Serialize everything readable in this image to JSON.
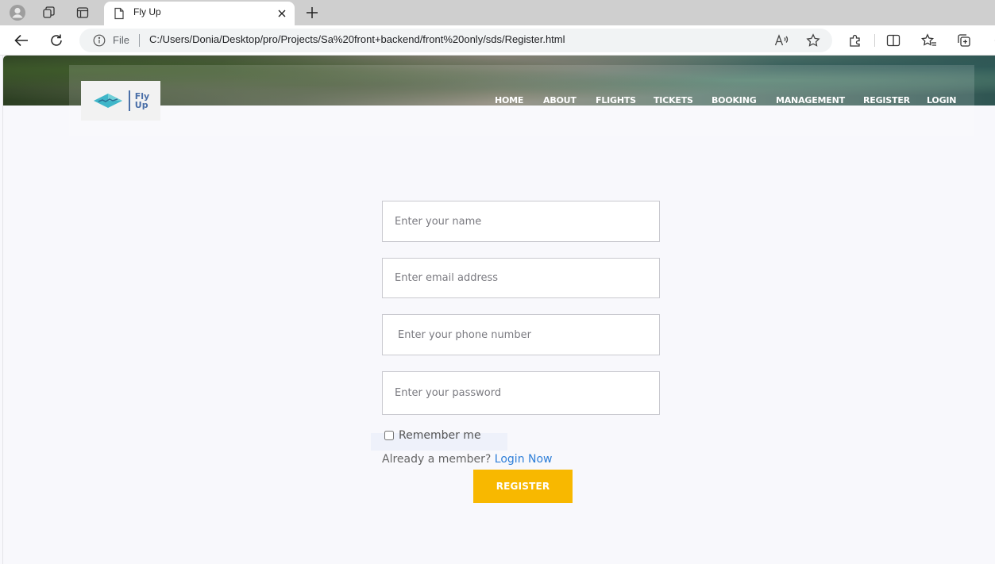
{
  "browser": {
    "tab_title": "Fly Up",
    "scheme_label": "File",
    "url": "C:/Users/Donia/Desktop/pro/Projects/Sa%20front+backend/front%20only/sds/Register.html"
  },
  "site": {
    "logo": {
      "line1": "Fly",
      "line2": "Up"
    },
    "nav": [
      "HOME",
      "ABOUT",
      "FLIGHTS",
      "TICKETS",
      "BOOKING",
      "MANAGEMENT",
      "REGISTER",
      "LOGIN"
    ]
  },
  "form": {
    "name_placeholder": "Enter your name",
    "email_placeholder": "Enter email address",
    "phone_placeholder": "Enter your phone number",
    "password_placeholder": "Enter your password",
    "remember_label": "Remember me",
    "member_text": "Already a member?",
    "login_link": "Login Now",
    "submit_label": "REGISTER"
  },
  "colors": {
    "accent": "#f8b800",
    "link": "#2f7fd8",
    "page_bg": "#f8f8fc"
  },
  "icons": [
    "profile-icon",
    "workspaces-icon",
    "tab-actions-icon",
    "page-icon",
    "close-icon",
    "plus-icon",
    "back-arrow-icon",
    "reload-icon",
    "info-icon",
    "read-aloud-icon",
    "star-icon",
    "extensions-icon",
    "split-screen-icon",
    "favorites-icon",
    "collections-icon"
  ]
}
